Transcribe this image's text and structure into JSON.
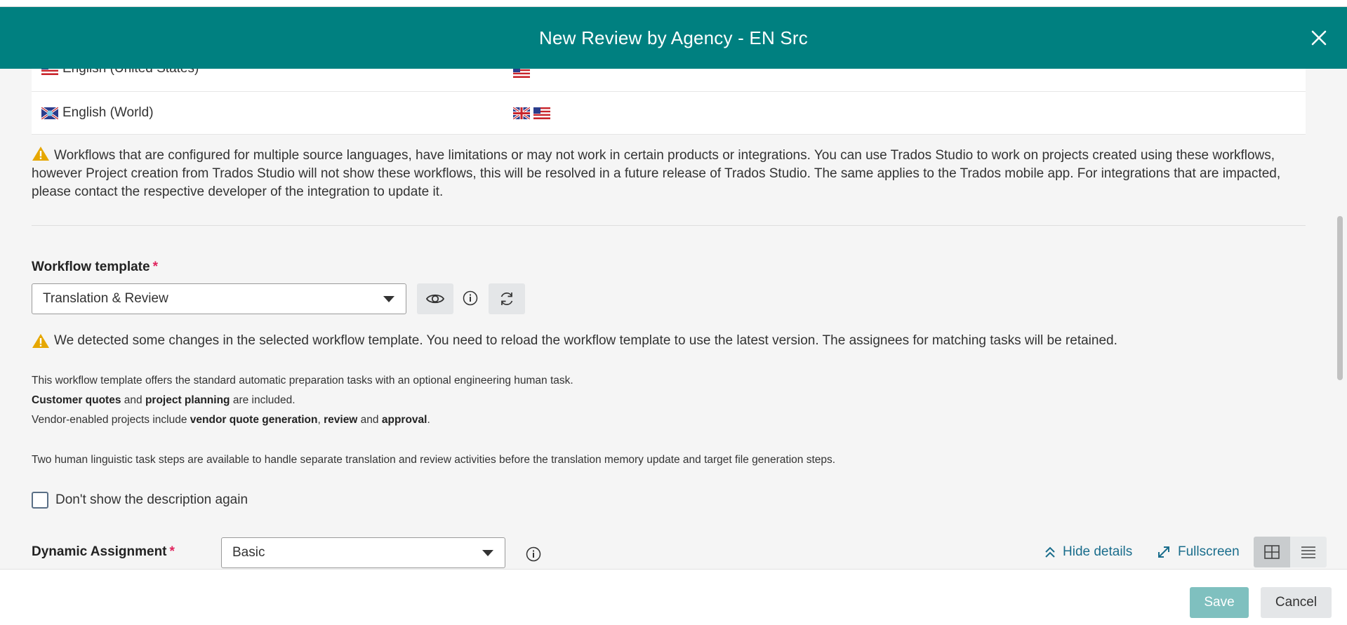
{
  "dialog": {
    "title": "New Review by Agency - EN Src"
  },
  "languages": [
    {
      "name": "English (United States)",
      "flags": [
        "us"
      ]
    },
    {
      "name": "English (World)",
      "flags": [
        "gb",
        "us"
      ]
    }
  ],
  "multi_source_warning": "Workflows that are configured for multiple source languages, have limitations or may not work in certain products or integrations. You can use Trados Studio to work on projects created using these workflows, however Project creation from Trados Studio will not show these workflows, this will be resolved in a future release of Trados Studio. The same applies to the Trados mobile app. For integrations that are impacted, please contact the respective developer of the integration to update it.",
  "workflow_template": {
    "label": "Workflow template",
    "required_mark": "*",
    "selected": "Translation & Review",
    "change_warning": "We detected some changes in the selected workflow template. You need to reload the workflow template to use the latest version. The assignees for matching tasks will be retained."
  },
  "description": {
    "line1": "This workflow template offers the standard automatic preparation tasks with an optional engineering human task.",
    "line2": {
      "b1": "Customer quotes",
      "t1": " and ",
      "b2": "project planning",
      "t2": " are included."
    },
    "line3": {
      "t1": "Vendor-enabled projects include ",
      "b1": "vendor quote generation",
      "t2": ", ",
      "b2": "review",
      "t3": " and ",
      "b3": "approval",
      "t4": "."
    },
    "line4": "Two human linguistic task steps are available to handle separate translation and review activities before the translation memory update and target file generation steps."
  },
  "dont_show_label": "Don't show the description again",
  "dynamic_assignment": {
    "label": "Dynamic Assignment",
    "required_mark": "*",
    "selected": "Basic"
  },
  "toolbar": {
    "hide_details": "Hide details",
    "fullscreen": "Fullscreen"
  },
  "footer": {
    "save": "Save",
    "cancel": "Cancel"
  },
  "colors": {
    "header": "#008080",
    "link": "#1a6d8c",
    "save_disabled": "#7fc0bf",
    "warning": "#e6a700",
    "required": "#e0245e"
  }
}
